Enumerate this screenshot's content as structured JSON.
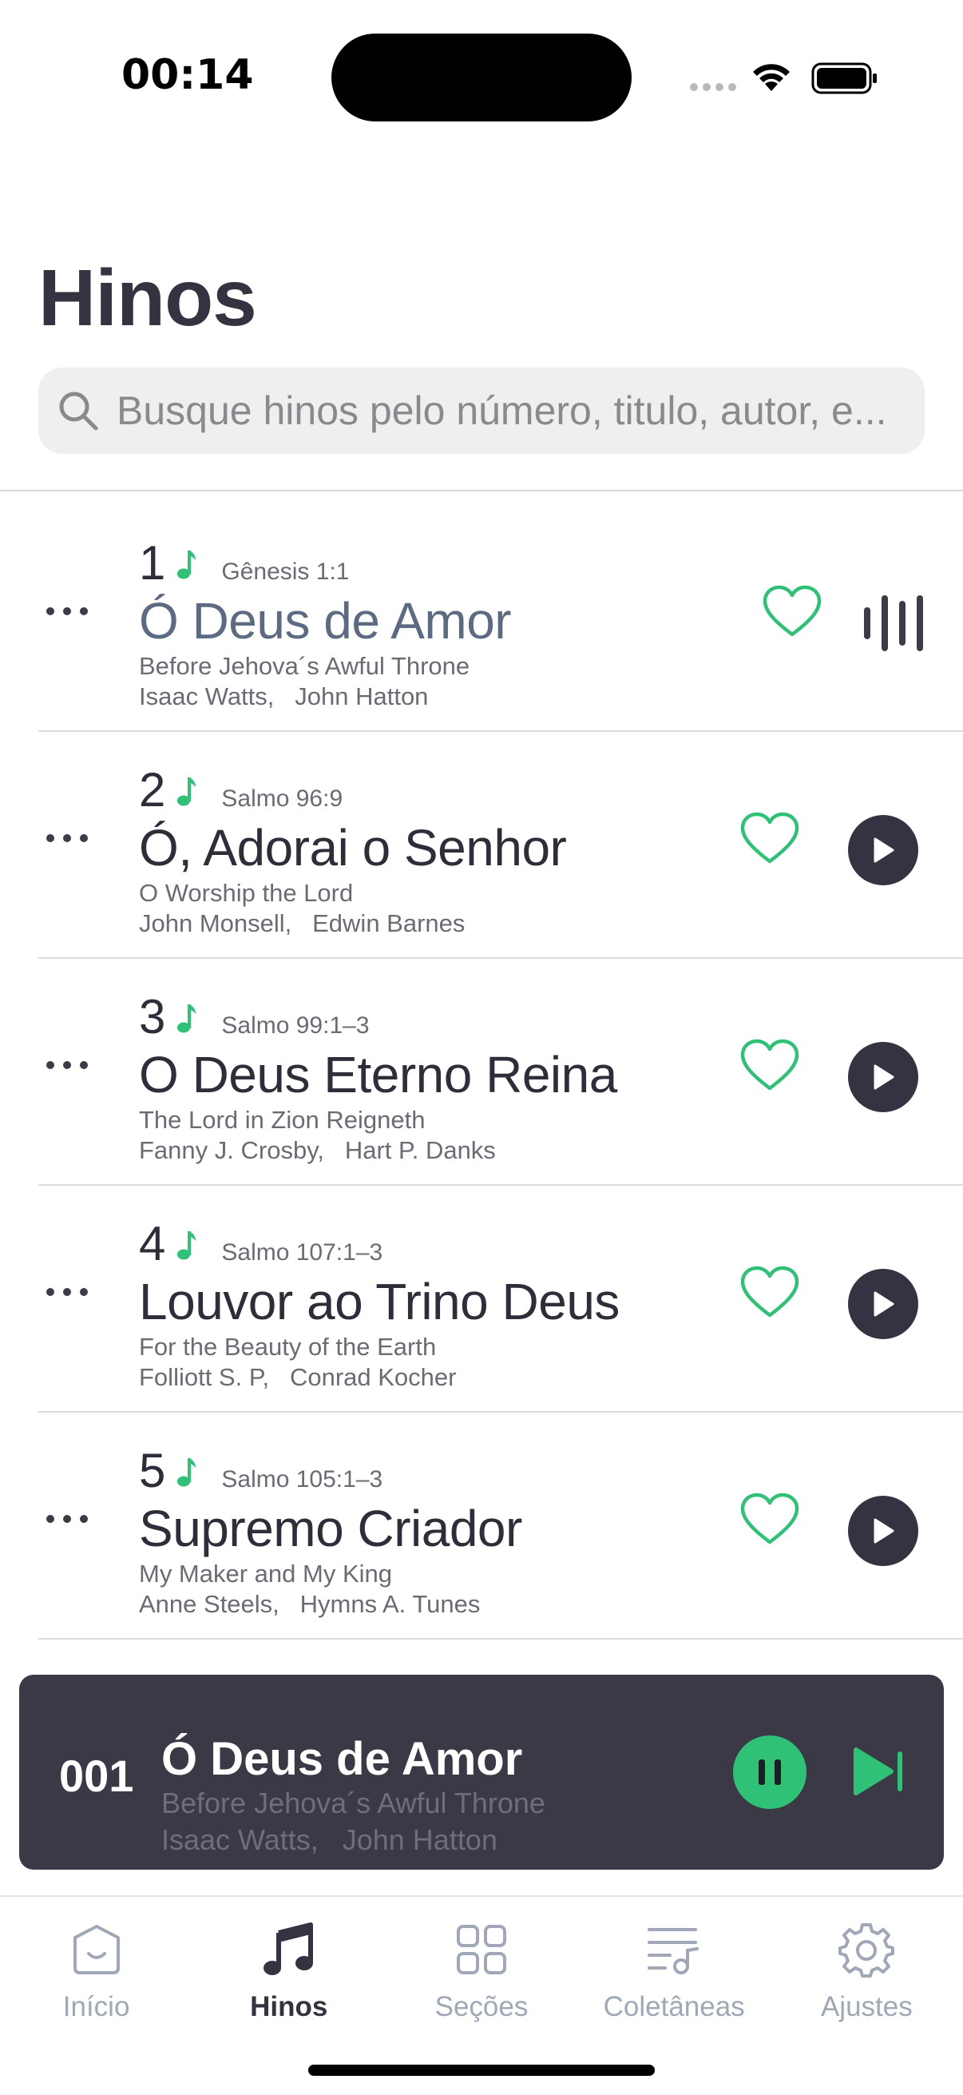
{
  "status_bar": {
    "time": "00:14"
  },
  "header": {
    "title": "Hinos"
  },
  "search": {
    "placeholder": "Busque hinos pelo número, titulo, autor, e..."
  },
  "colors": {
    "accent": "#2FC277",
    "dark": "#343341",
    "active_title": "#5D6B82"
  },
  "hymns": [
    {
      "number": "1",
      "reference": "Gênesis 1:1",
      "title": "Ó Deus de Amor",
      "original": "Before Jehova´s Awful Throne",
      "author1": "Isaac Watts,",
      "author2": "John Hatton",
      "playing": true
    },
    {
      "number": "2",
      "reference": "Salmo 96:9",
      "title": "Ó, Adorai o Senhor",
      "original": "O Worship the Lord",
      "author1": "John Monsell,",
      "author2": "Edwin Barnes",
      "playing": false
    },
    {
      "number": "3",
      "reference": "Salmo 99:1–3",
      "title": "O Deus Eterno Reina",
      "original": "The Lord in Zion Reigneth",
      "author1": "Fanny J. Crosby,",
      "author2": "Hart P. Danks",
      "playing": false
    },
    {
      "number": "4",
      "reference": "Salmo 107:1–3",
      "title": "Louvor ao Trino Deus",
      "original": "For the Beauty of the Earth",
      "author1": "Folliott S. P,",
      "author2": "Conrad Kocher",
      "playing": false
    },
    {
      "number": "5",
      "reference": "Salmo 105:1–3",
      "title": "Supremo Criador",
      "original": "My Maker and My King",
      "author1": "Anne Steels,",
      "author2": "Hymns A. Tunes",
      "playing": false
    }
  ],
  "player": {
    "number": "001",
    "title": "Ó Deus de Amor",
    "original": "Before Jehova´s Awful Throne",
    "author1": "Isaac Watts,",
    "author2": "John Hatton"
  },
  "tabs": [
    {
      "label": "Início",
      "icon": "home-icon"
    },
    {
      "label": "Hinos",
      "icon": "music-notes-icon",
      "active": true
    },
    {
      "label": "Seções",
      "icon": "grid-icon"
    },
    {
      "label": "Coletâneas",
      "icon": "playlist-icon"
    },
    {
      "label": "Ajustes",
      "icon": "gear-icon"
    }
  ]
}
